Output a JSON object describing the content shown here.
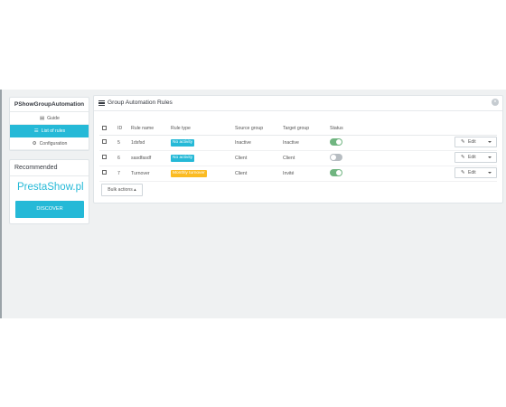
{
  "sidebar": {
    "title": "PShowGroupAutomation",
    "items": [
      {
        "icon": "book-icon",
        "glyph": "▤",
        "label": "Guide",
        "active": false
      },
      {
        "icon": "list-icon",
        "glyph": "☰",
        "label": "List of rules",
        "active": true
      },
      {
        "icon": "cogs-icon",
        "glyph": "⚙",
        "label": "Configuration",
        "active": false
      }
    ]
  },
  "recommended": {
    "title": "Recommended",
    "brand": "PrestaShow.pl",
    "button": "DISCOVER"
  },
  "panel": {
    "title": "Group Automation Rules",
    "close_glyph": "×",
    "columns": [
      "",
      "ID",
      "Rule name",
      "Rule type",
      "Source group",
      "Target group",
      "Status",
      ""
    ],
    "rows": [
      {
        "id": "5",
        "name": "1dsfsd",
        "type": "No activity",
        "type_color": "#25b9d7",
        "source": "Inactive",
        "target": "Inactive",
        "status": true,
        "action": "Edit"
      },
      {
        "id": "6",
        "name": "sasdfasdf",
        "type": "No activity",
        "type_color": "#25b9d7",
        "source": "Client",
        "target": "Client",
        "status": false,
        "action": "Edit"
      },
      {
        "id": "7",
        "name": "Turnover",
        "type": "Monthly turnover",
        "type_color": "#fbbb22",
        "source": "Client",
        "target": "Invité",
        "status": true,
        "action": "Edit"
      }
    ],
    "bulk_label": "Bulk actions ▴"
  },
  "colors": {
    "accent": "#25b9d7",
    "warning": "#fbbb22",
    "toggle_on": "#70b580",
    "toggle_off": "#b7bdc2"
  }
}
